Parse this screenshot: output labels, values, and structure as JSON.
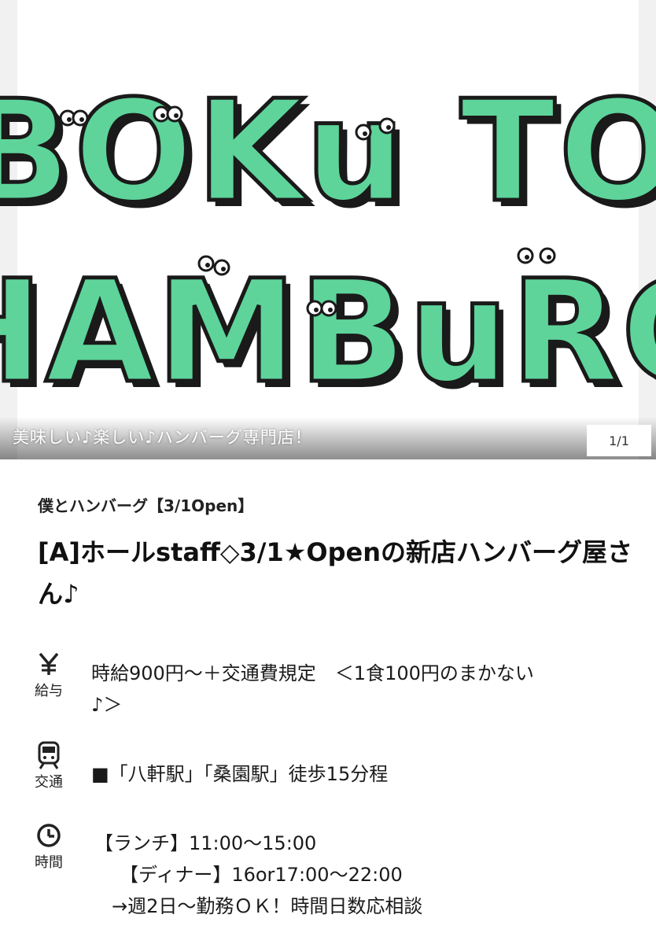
{
  "hero": {
    "logo_line1": "BOKu TO",
    "logo_line2": "HAMBuRG",
    "caption": "美味しい♪楽しい♪ハンバーグ専門店！",
    "counter": "1/1",
    "logo_color": "#5ed49a",
    "logo_shadow": "#1a1a1a"
  },
  "shop": {
    "name": "僕とハンバーグ【3/1Open】"
  },
  "job": {
    "title": "[A]ホールstaff◇3/1★Openの新店ハンバーグ屋さん♪"
  },
  "salary": {
    "icon": "yen-icon",
    "label": "給与",
    "line1": "時給900円～＋交通費規定　＜1食100円のまかない",
    "line2": "♪＞"
  },
  "access": {
    "icon": "train-icon",
    "label": "交通",
    "value": "■「八軒駅」「桑園駅」徒歩15分程"
  },
  "hours": {
    "icon": "clock-icon",
    "label": "時間",
    "line1": "【ランチ】11:00～15:00",
    "line2": "【ディナー】16or17:00～22:00",
    "line3": "→週2日～勤務ＯＫ！時間日数応相談"
  }
}
